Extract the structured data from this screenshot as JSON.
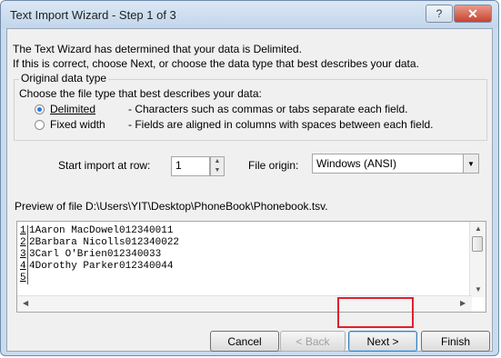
{
  "window": {
    "title": "Text Import Wizard - Step 1 of 3",
    "help_label": "?",
    "close_label": "✕"
  },
  "intro": {
    "line1": "The Text Wizard has determined that your data is Delimited.",
    "line2": "If this is correct, choose Next, or choose the data type that best describes your data."
  },
  "original_data_type": {
    "group_label": "Original data type",
    "prompt": "Choose the file type that best describes your data:",
    "options": [
      {
        "label": "Delimited",
        "description": "- Characters such as commas or tabs separate each field.",
        "selected": true
      },
      {
        "label": "Fixed width",
        "description": "- Fields are aligned in columns with spaces between each field.",
        "selected": false
      }
    ]
  },
  "start_import": {
    "label": "Start import at row:",
    "value": "1"
  },
  "file_origin": {
    "label": "File origin:",
    "value": "Windows (ANSI)"
  },
  "preview": {
    "label": "Preview of file D:\\Users\\YIT\\Desktop\\PhoneBook\\Phonebook.tsv.",
    "rows": [
      {
        "num": "1",
        "text": "1Aaron MacDowel012340011"
      },
      {
        "num": "2",
        "text": "2Barbara Nicolls012340022"
      },
      {
        "num": "3",
        "text": "3Carl O'Brien012340033"
      },
      {
        "num": "4",
        "text": "4Dorothy Parker012340044"
      },
      {
        "num": "5",
        "text": ""
      }
    ]
  },
  "buttons": {
    "cancel": "Cancel",
    "back": "< Back",
    "next": "Next >",
    "finish": "Finish"
  },
  "colors": {
    "highlight": "#e0202d",
    "title_bar": "#c9dcef"
  }
}
